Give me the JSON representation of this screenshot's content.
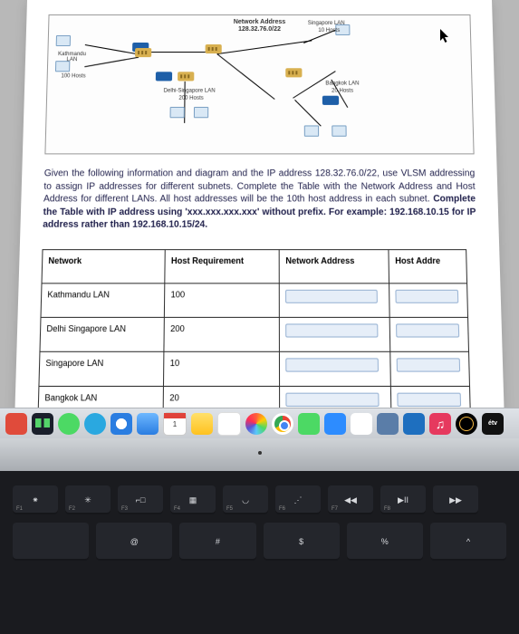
{
  "diagram": {
    "title_line1": "Network Address",
    "title_line2": "128.32.76.0/22",
    "labels": {
      "kathmandu_lan": "Kathmandu LAN",
      "kathmandu_hosts": "100 Hosts",
      "singapore_lan": "Singapore LAN",
      "singapore_hosts": "10 Hosts",
      "delhi_singapore_lan": "Delhi-Singapore LAN",
      "delhi_singapore_hosts": "200 Hosts",
      "bangkok_lan": "Bangkok LAN",
      "bangkok_hosts": "20 Hosts"
    }
  },
  "question": {
    "text_plain": "Given the following information and diagram and the IP address 128.32.76.0/22, use VLSM addressing to assign IP addresses for different subnets. Complete the Table with the Network Address and Host Address for different LANs. All host addresses will be the 10th host address in each subnet. ",
    "text_bold": "Complete the Table with IP address using 'xxx.xxx.xxx.xxx' without prefix. For example: 192.168.10.15 for IP address rather than 192.168.10.15/24."
  },
  "table": {
    "headers": {
      "col1": "Network",
      "col2": "Host Requirement",
      "col3": "Network Address",
      "col4": "Host Addre"
    },
    "rows": [
      {
        "network": "Kathmandu LAN",
        "hostreq": "100"
      },
      {
        "network": "Delhi Singapore LAN",
        "hostreq": "200"
      },
      {
        "network": "Singapore LAN",
        "hostreq": "10"
      },
      {
        "network": "Bangkok LAN",
        "hostreq": "20"
      }
    ]
  },
  "dock": {
    "calendar_day": "1",
    "music_glyph": "♫",
    "tv_label": "étv"
  },
  "keyboard": {
    "fn_row": [
      {
        "glyph": "⁕",
        "sub": "F1"
      },
      {
        "glyph": "✳",
        "sub": "F2"
      },
      {
        "glyph": "⌐□",
        "sub": "F3"
      },
      {
        "glyph": "▦",
        "sub": "F4"
      },
      {
        "glyph": "◡",
        "sub": "F5"
      },
      {
        "glyph": "⋰",
        "sub": "F6"
      },
      {
        "glyph": "◀◀",
        "sub": "F7"
      },
      {
        "glyph": "▶II",
        "sub": "F8"
      },
      {
        "glyph": "▶▶",
        "sub": ""
      }
    ],
    "num_row": [
      {
        "top": "",
        "main": ""
      },
      {
        "top": "@",
        "main": ""
      },
      {
        "top": "#",
        "main": ""
      },
      {
        "top": "$",
        "main": ""
      },
      {
        "top": "%",
        "main": ""
      },
      {
        "top": "^",
        "main": ""
      }
    ]
  }
}
